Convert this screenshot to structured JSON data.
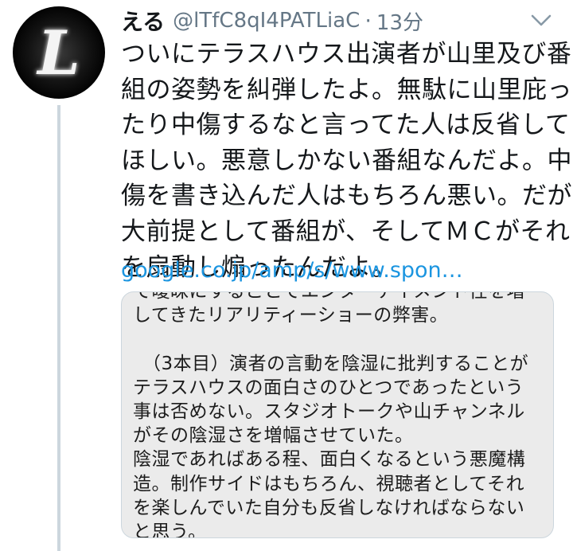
{
  "tweet": {
    "display_name": "える",
    "handle": "@lTfC8qI4PATLiaC",
    "separator": "·",
    "time": "13分",
    "avatar_letter": "L",
    "body_lines": [
      "ついにテラスハウス出演者が山里及び番",
      "組の姿勢を糾弾したよ。無駄に山里庇っ",
      "たり中傷するなと言ってた人は反省して",
      "ほしい。悪意しかない番組なんだよ。中",
      "傷を書き込んだ人はもちろん悪い。だが",
      "大前提として番組が、そしてＭＣがそれ",
      "を扇動し煽ったんだよ。"
    ],
    "link_text": "google.co.jp/amp/s/www.spon…",
    "card_lines": [
      "で曖昧にすることでエンターテイメント性を増",
      "してきたリアリティーショーの弊害。",
      "",
      "　（3本目）演者の言動を陰湿に批判することが",
      "テラスハウスの面白さのひとつであったという",
      "事は否めない。スタジオトークや山チャンネル",
      "がその陰湿さを増幅させていた。",
      "陰湿であればある程、面白くなるという悪魔構",
      "造。制作サイドはもちろん、視聴者としてそれ",
      "を楽しんでいた自分も反省しなければならない",
      "と思う。"
    ]
  },
  "colors": {
    "text_primary": "#14171a",
    "text_secondary": "#657786",
    "link": "#1b95e0",
    "card_background": "#ebebeb",
    "thread_line": "#ccd6dd"
  },
  "icons": {
    "caret": "chevron-down-icon"
  }
}
